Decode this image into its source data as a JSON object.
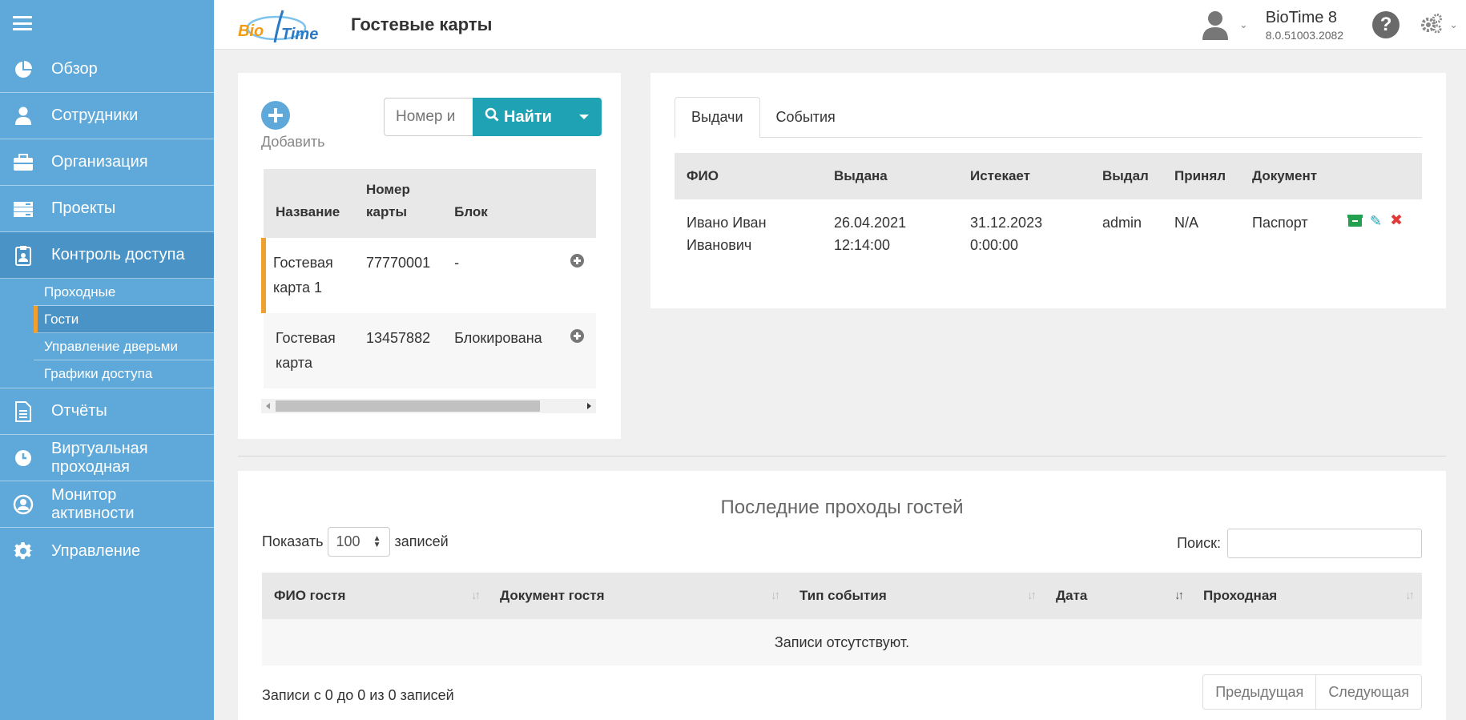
{
  "sidebar": {
    "items": [
      {
        "label": "Обзор",
        "icon": "pie-chart-icon"
      },
      {
        "label": "Сотрудники",
        "icon": "user-icon"
      },
      {
        "label": "Организация",
        "icon": "briefcase-icon"
      },
      {
        "label": "Проекты",
        "icon": "tray-icon"
      },
      {
        "label": "Контроль доступа",
        "icon": "clipboard-icon"
      },
      {
        "label": "Отчёты",
        "icon": "document-icon"
      },
      {
        "label": "Виртуальная проходная",
        "icon": "clock-icon"
      },
      {
        "label": "Монитор активности",
        "icon": "user-circle-icon"
      },
      {
        "label": "Управление",
        "icon": "gear-icon"
      }
    ],
    "subitems": [
      {
        "label": "Проходные"
      },
      {
        "label": "Гости"
      },
      {
        "label": "Управление дверьми"
      },
      {
        "label": "Графики доступа"
      }
    ]
  },
  "header": {
    "logo_text": "BioTime",
    "title": "Гостевые карты",
    "version_name": "BioTime 8",
    "version_number": "8.0.51003.2082",
    "help_symbol": "?"
  },
  "cards_panel": {
    "add_label": "Добавить",
    "search_placeholder": "Номер и",
    "find_label": "Найти",
    "columns": [
      "Название",
      "Номер карты",
      "Блок"
    ],
    "rows": [
      {
        "name": "Гостевая карта 1",
        "number": "77770001",
        "block": "-"
      },
      {
        "name": "Гостевая карта",
        "number": "13457882",
        "block": "Блокирована"
      }
    ]
  },
  "issues_panel": {
    "tabs": [
      "Выдачи",
      "События"
    ],
    "columns": [
      "ФИО",
      "Выдана",
      "Истекает",
      "Выдал",
      "Принял",
      "Документ"
    ],
    "rows": [
      {
        "fio": "Ивано Иван Иванович",
        "issued": "26.04.2021 12:14:00",
        "expires": "31.12.2023 0:00:00",
        "issuer": "admin",
        "receiver": "N/A",
        "document": "Паспорт"
      }
    ]
  },
  "passes_panel": {
    "title": "Последние проходы гостей",
    "show_label": "Показать",
    "page_size": "100",
    "records_label": "записей",
    "search_label": "Поиск:",
    "columns": [
      "ФИО гостя",
      "Документ гостя",
      "Тип события",
      "Дата",
      "Проходная"
    ],
    "empty_text": "Записи отсутствуют.",
    "info_text": "Записи с 0 до 0 из 0 записей",
    "prev_label": "Предыдущая",
    "next_label": "Следующая"
  }
}
